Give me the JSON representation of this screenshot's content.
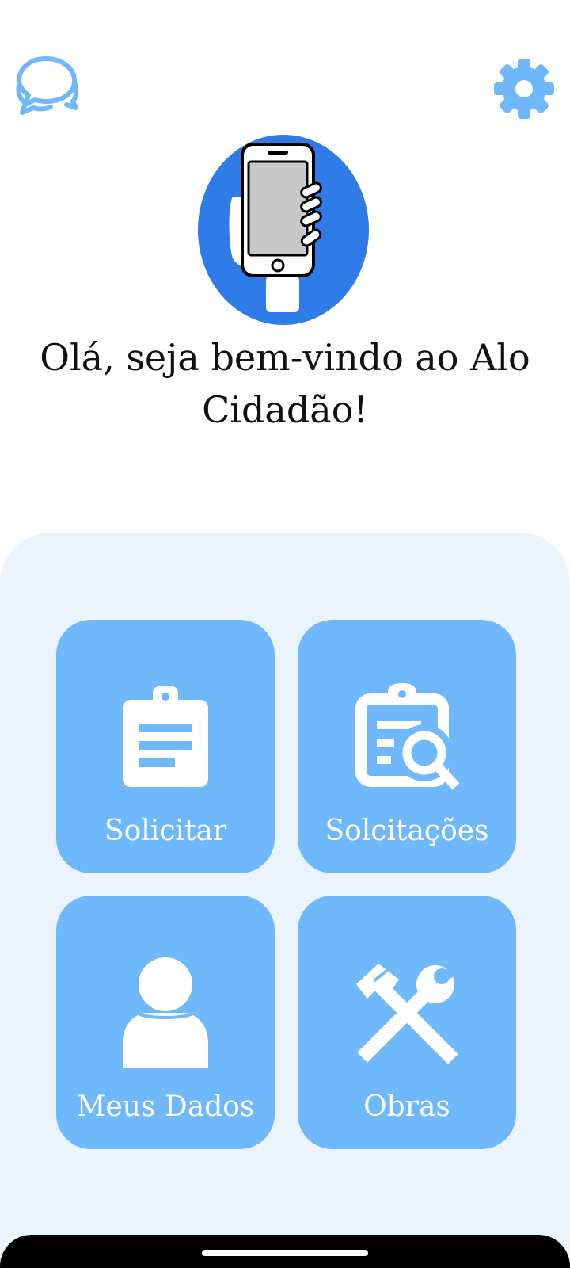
{
  "header": {
    "chat_icon": "chat-bubbles-icon",
    "settings_icon": "gear-icon"
  },
  "hero": {
    "icon": "hand-holding-phone-icon"
  },
  "welcome": {
    "line1": "Olá, seja bem-vindo ao Alo",
    "line2": "Cidadão!"
  },
  "menu": [
    {
      "label": "Solicitar",
      "icon": "clipboard-icon"
    },
    {
      "label": "Solcitações",
      "icon": "clipboard-search-icon"
    },
    {
      "label": "Meus Dados",
      "icon": "user-icon"
    },
    {
      "label": "Obras",
      "icon": "tools-icon"
    }
  ],
  "colors": {
    "accent": "#6fb8fb",
    "hero_circle": "#2f7be8",
    "panel_bg": "#ebf4fc"
  }
}
